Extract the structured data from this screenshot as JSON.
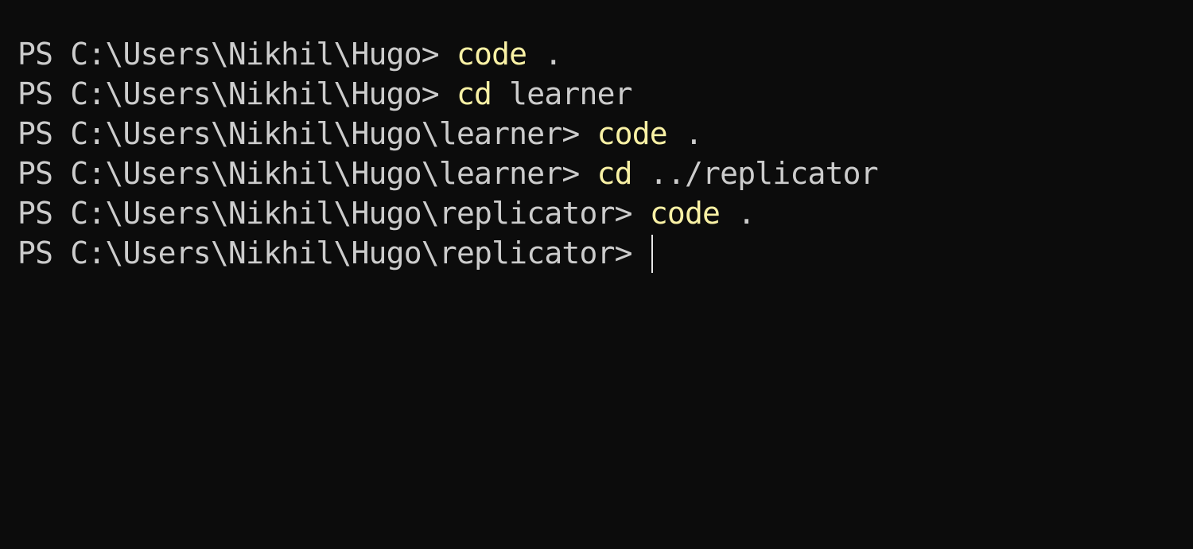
{
  "terminal": {
    "lines": [
      {
        "prompt": "PS C:\\Users\\Nikhil\\Hugo> ",
        "command": "code",
        "args": " ."
      },
      {
        "prompt": "PS C:\\Users\\Nikhil\\Hugo> ",
        "command": "cd",
        "args": " learner"
      },
      {
        "prompt": "PS C:\\Users\\Nikhil\\Hugo\\learner> ",
        "command": "code",
        "args": " ."
      },
      {
        "prompt": "PS C:\\Users\\Nikhil\\Hugo\\learner> ",
        "command": "cd",
        "args": " ../replicator"
      },
      {
        "prompt": "PS C:\\Users\\Nikhil\\Hugo\\replicator> ",
        "command": "code",
        "args": " ."
      },
      {
        "prompt": "PS C:\\Users\\Nikhil\\Hugo\\replicator> ",
        "command": "",
        "args": ""
      }
    ]
  },
  "colors": {
    "background": "#0c0c0c",
    "text": "#cccccc",
    "command": "#f9f1a5"
  }
}
